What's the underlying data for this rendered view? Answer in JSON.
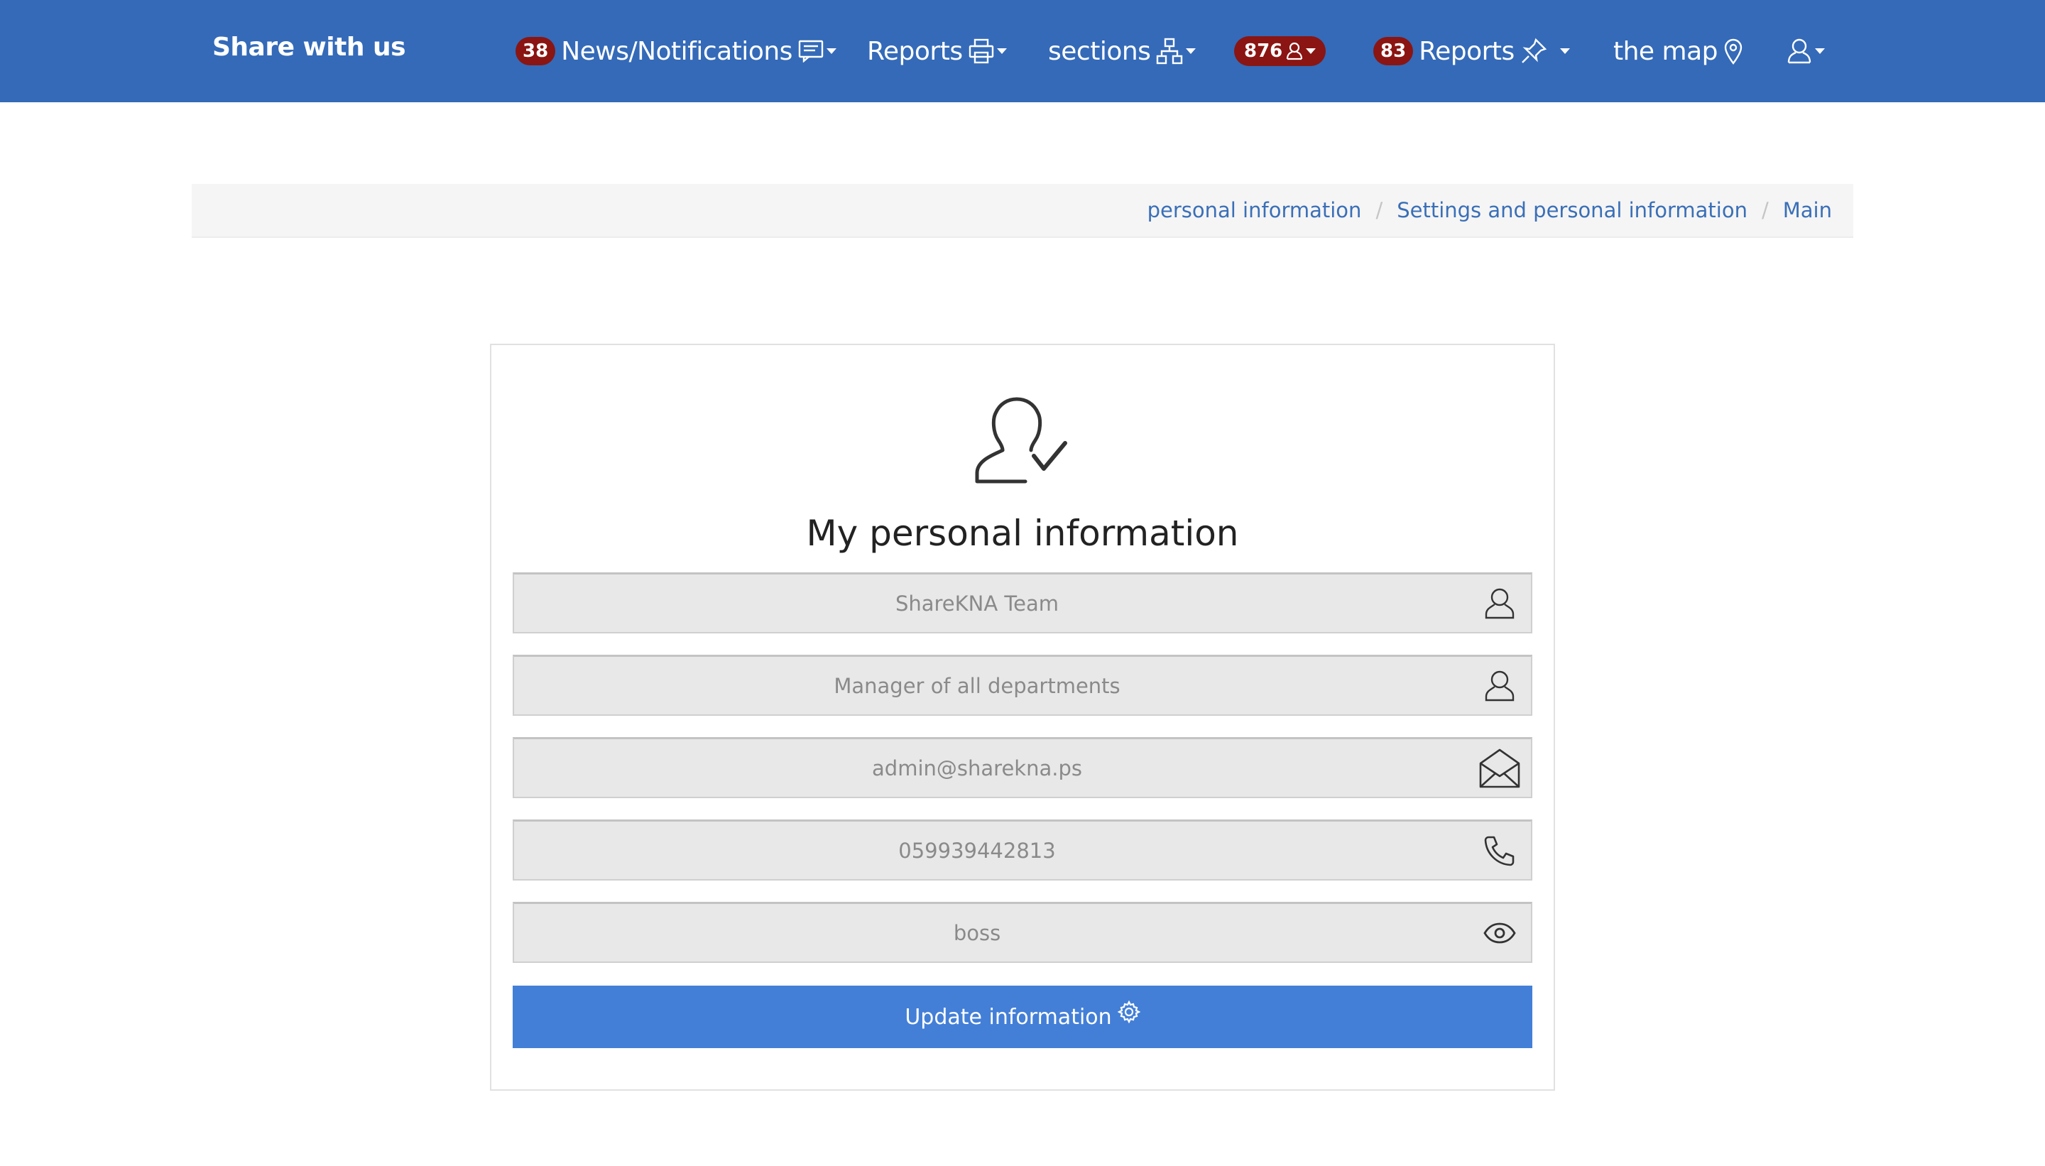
{
  "navbar": {
    "brand": "Share with us",
    "news": {
      "badge": "38",
      "label": "News/Notifications"
    },
    "reports_print": {
      "label": "Reports"
    },
    "sections": {
      "label": "sections"
    },
    "users": {
      "badge": "876"
    },
    "reports_pin": {
      "badge": "83",
      "label": "Reports"
    },
    "map": {
      "label": "the map"
    }
  },
  "breadcrumb": {
    "items": [
      "personal information",
      "Settings and personal information",
      "Main"
    ],
    "separator": "/"
  },
  "form": {
    "title": "My personal information",
    "fields": [
      {
        "placeholder": "ShareKNA Team",
        "icon": "user-icon"
      },
      {
        "placeholder": "Manager of all departments",
        "icon": "user-icon"
      },
      {
        "placeholder": "admin@sharekna.ps",
        "icon": "envelope-icon"
      },
      {
        "placeholder": "059939442813",
        "icon": "phone-icon"
      },
      {
        "placeholder": "boss",
        "icon": "eye-icon"
      }
    ],
    "submit_label": "Update information"
  },
  "colors": {
    "navbar": "#346ab8",
    "badge": "#8a1512",
    "link": "#3a6fb7",
    "button": "#437fd7"
  }
}
